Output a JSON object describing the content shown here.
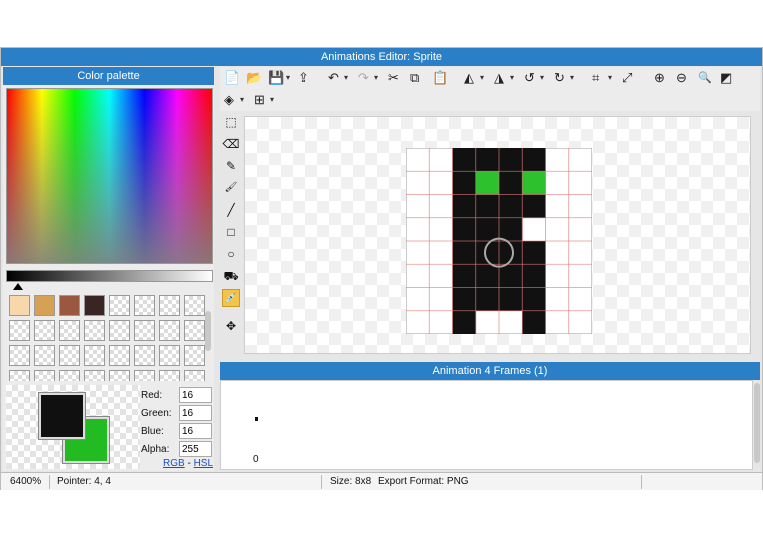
{
  "window": {
    "title": "Animations Editor: Sprite"
  },
  "palette": {
    "title": "Color palette",
    "swatch_colors": [
      "#f8d7ad",
      "#d6a056",
      "#9b5840",
      "#3a2525"
    ],
    "fg_color": "#101010",
    "bg_color": "#22bb22"
  },
  "color_fields": {
    "red_label": "Red:",
    "red": "16",
    "green_label": "Green:",
    "green": "16",
    "blue_label": "Blue:",
    "blue": "16",
    "alpha_label": "Alpha:",
    "alpha": "255",
    "rgb_link": "RGB",
    "sep": "-",
    "hsl_link": "HSL"
  },
  "toolbar": {
    "new_icon": "📄",
    "open_icon": "📂",
    "save_icon": "💾",
    "export_icon": "⇪",
    "undo_icon": "↶",
    "redo_icon": "↷",
    "cut_icon": "✂",
    "copy_icon": "⧉",
    "paste_icon": "📋",
    "flip_h_icon": "◭",
    "flip_v_icon": "◮",
    "rotate_ccw_icon": "↺",
    "rotate_cw_icon": "↻",
    "crop_icon": "⌗",
    "resize_icon": "⤢",
    "zoom_in_icon": "⊕",
    "zoom_out_icon": "⊖",
    "zoom_fit_icon": "🔍",
    "bg_toggle_icon": "◩",
    "layers_icon": "◈",
    "grid_icon": "⊞",
    "dropdown": "▾"
  },
  "tools": {
    "select": "⬚",
    "eraser": "⌫",
    "pencil": "✎",
    "brush": "🖌",
    "line": "╱",
    "rectangle": "□",
    "ellipse": "○",
    "fill": "⛟",
    "eyedropper": "💉",
    "move": "✥"
  },
  "sprite": {
    "colors": {
      "black": "#111111",
      "green": "#2dc22d",
      "grid": "#e07a7a"
    },
    "pixels": [
      "..KKKK..",
      "..KGKG..",
      "..KKKK..",
      "..KKK...",
      "..KKKK..",
      "..KKKK..",
      "..KKKK..",
      "..K..K.."
    ]
  },
  "animation": {
    "title": "Animation 4 Frames (1)",
    "frame_index": "0"
  },
  "status": {
    "zoom": "6400%",
    "pointer": "Pointer: 4, 4",
    "size": "Size: 8x8",
    "export_format": "Export Format: PNG"
  }
}
